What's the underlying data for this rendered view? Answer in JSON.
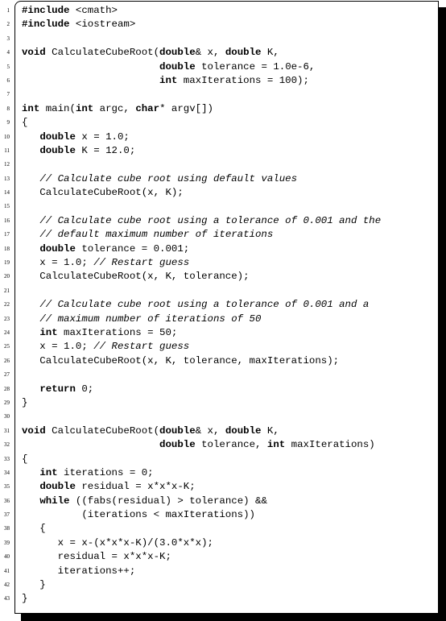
{
  "listing": {
    "keywords": [
      "#include",
      "void",
      "double",
      "int",
      "char",
      "while",
      "return"
    ],
    "lines": [
      "#include <cmath>",
      "#include <iostream>",
      "",
      "void CalculateCubeRoot(double& x, double K,",
      "                       double tolerance = 1.0e-6,",
      "                       int maxIterations = 100);",
      "",
      "int main(int argc, char* argv[])",
      "{",
      "   double x = 1.0;",
      "   double K = 12.0;",
      "",
      "   // Calculate cube root using default values",
      "   CalculateCubeRoot(x, K);",
      "",
      "   // Calculate cube root using a tolerance of 0.001 and the",
      "   // default maximum number of iterations",
      "   double tolerance = 0.001;",
      "   x = 1.0; // Restart guess",
      "   CalculateCubeRoot(x, K, tolerance);",
      "",
      "   // Calculate cube root using a tolerance of 0.001 and a",
      "   // maximum number of iterations of 50",
      "   int maxIterations = 50;",
      "   x = 1.0; // Restart guess",
      "   CalculateCubeRoot(x, K, tolerance, maxIterations);",
      "",
      "   return 0;",
      "}",
      "",
      "void CalculateCubeRoot(double& x, double K,",
      "                       double tolerance, int maxIterations)",
      "{",
      "   int iterations = 0;",
      "   double residual = x*x*x-K;",
      "   while ((fabs(residual) > tolerance) &&",
      "          (iterations < maxIterations))",
      "   {",
      "      x = x-(x*x*x-K)/(3.0*x*x);",
      "      residual = x*x*x-K;",
      "      iterations++;",
      "   }",
      "}"
    ]
  }
}
